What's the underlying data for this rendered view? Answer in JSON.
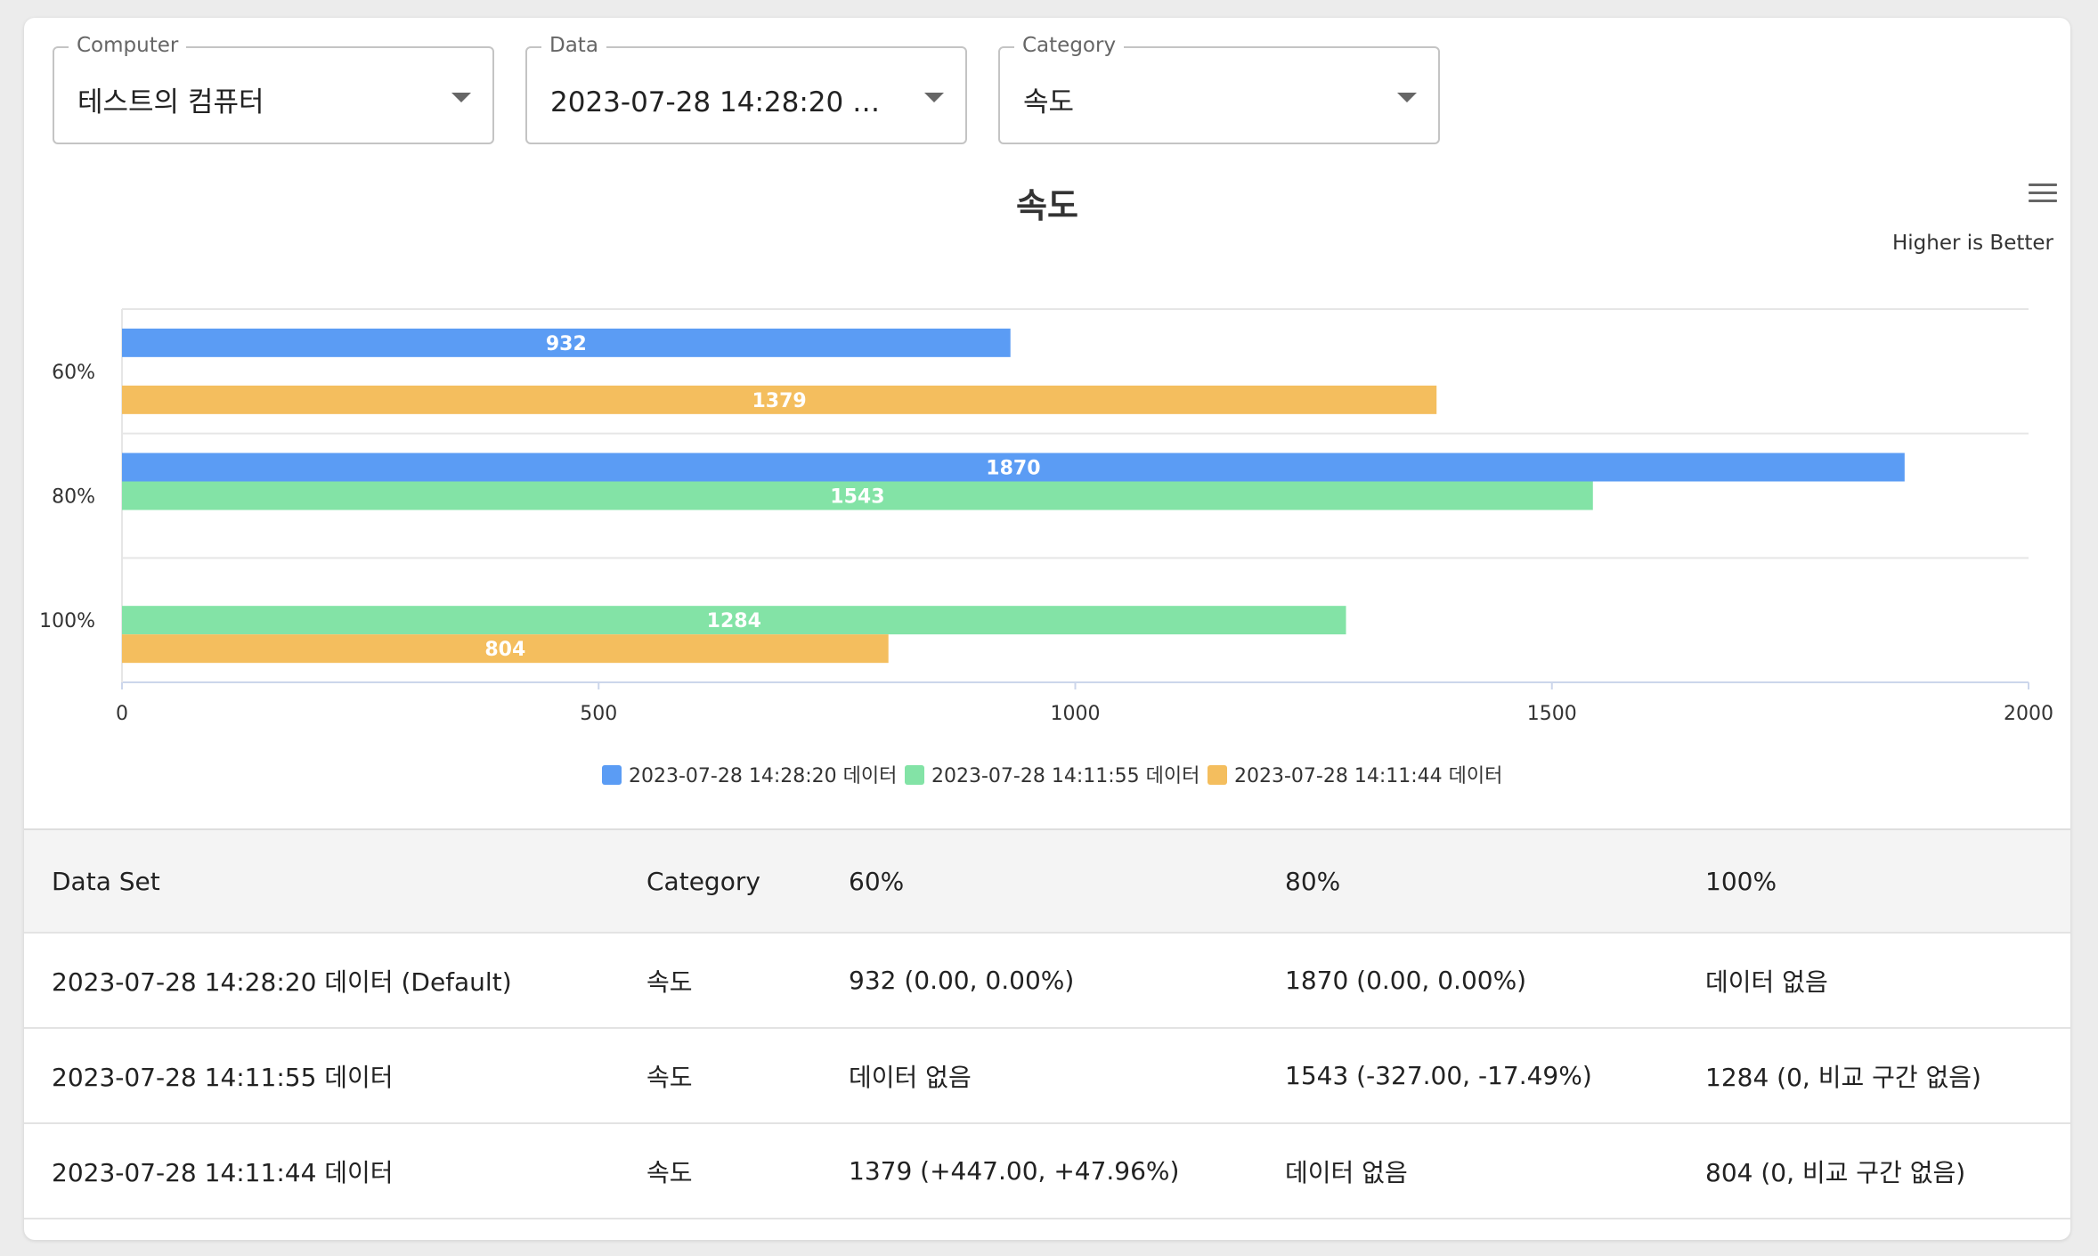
{
  "filters": {
    "computer": {
      "label": "Computer",
      "value": "테스트의 컴퓨터"
    },
    "data": {
      "label": "Data",
      "value": "2023-07-28 14:28:20 데이..."
    },
    "category": {
      "label": "Category",
      "value": "속도"
    }
  },
  "chart_data": {
    "type": "bar",
    "orientation": "horizontal",
    "title": "속도",
    "subtitle": "Higher is Better",
    "categories": [
      "60%",
      "80%",
      "100%"
    ],
    "series": [
      {
        "name": "2023-07-28 14:28:20 데이터",
        "color": "#5b9cf4",
        "values": [
          932,
          1870,
          null
        ]
      },
      {
        "name": "2023-07-28 14:11:55 데이터",
        "color": "#83e3a6",
        "values": [
          null,
          1543,
          1284
        ]
      },
      {
        "name": "2023-07-28 14:11:44 데이터",
        "color": "#f4be5e",
        "values": [
          1379,
          null,
          804
        ]
      }
    ],
    "xlim": [
      0,
      2000
    ],
    "xticks": [
      "0",
      "500",
      "1000",
      "1500",
      "2000"
    ],
    "legend_position": "bottom",
    "grid": true,
    "data_labels": true
  },
  "table": {
    "headers": [
      "Data Set",
      "Category",
      "60%",
      "80%",
      "100%"
    ],
    "rows": [
      [
        "2023-07-28 14:28:20 데이터 (Default)",
        "속도",
        "932 (0.00, 0.00%)",
        "1870 (0.00, 0.00%)",
        "데이터 없음"
      ],
      [
        "2023-07-28 14:11:55 데이터",
        "속도",
        "데이터 없음",
        "1543 (-327.00, -17.49%)",
        "1284 (0, 비교 구간 없음)"
      ],
      [
        "2023-07-28 14:11:44 데이터",
        "속도",
        "1379 (+447.00, +47.96%)",
        "데이터 없음",
        "804 (0, 비교 구간 없음)"
      ]
    ]
  }
}
